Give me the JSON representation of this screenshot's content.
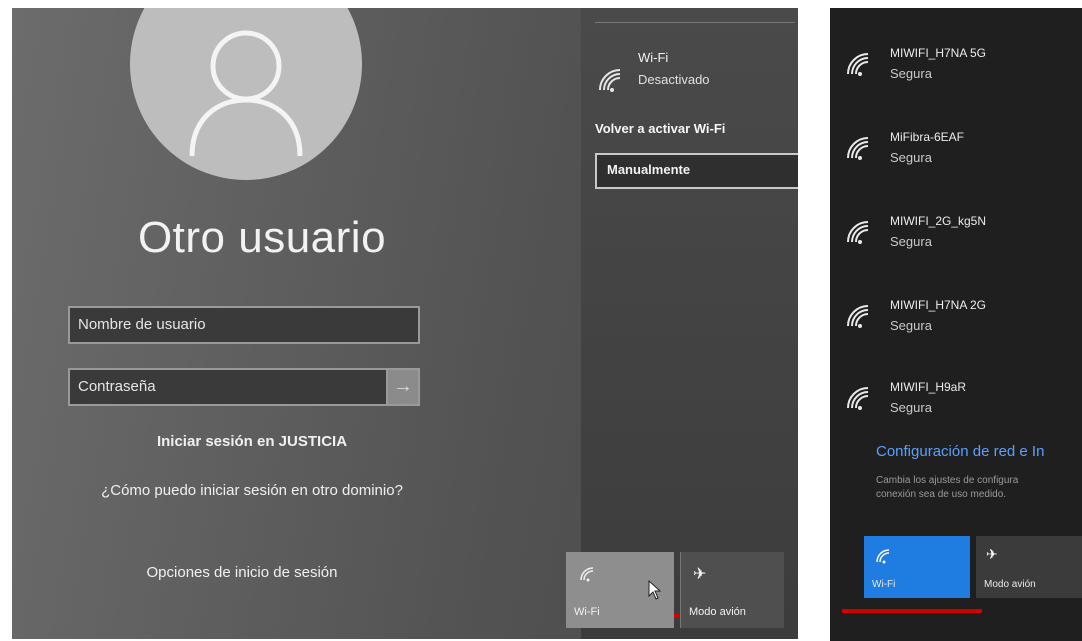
{
  "login": {
    "title": "Otro usuario",
    "username_placeholder": "Nombre de usuario",
    "password_placeholder": "Contraseña",
    "sign_in_justicia": "Iniciar sesión en JUSTICIA",
    "other_domain": "¿Cómo puedo iniciar sesión en otro dominio?",
    "sign_in_options": "Opciones de inicio de sesión"
  },
  "wifi_panel": {
    "wifi_name": "Wi-Fi",
    "wifi_state": "Desactivado",
    "reactivate_label": "Volver a activar Wi-Fi",
    "reactivate_value": "Manualmente",
    "tiles": [
      {
        "label": "Wi-Fi",
        "icon": "wifi-icon"
      },
      {
        "label": "Modo avión",
        "icon": "airplane-icon"
      }
    ]
  },
  "networks": [
    {
      "name": "MIWIFI_H7NA 5G",
      "status": "Segura"
    },
    {
      "name": "MiFibra-6EAF",
      "status": "Segura"
    },
    {
      "name": "MIWIFI_2G_kg5N",
      "status": "Segura"
    },
    {
      "name": "MIWIFI_H7NA 2G",
      "status": "Segura"
    },
    {
      "name": "MIWIFI_H9aR",
      "status": "Segura"
    }
  ],
  "network_settings": {
    "link": "Configuración de red e In",
    "desc_line1": "Cambia los ajustes de configura",
    "desc_line2": "conexión sea de uso medido."
  },
  "right_tiles": [
    {
      "label": "Wi-Fi",
      "icon": "wifi-icon"
    },
    {
      "label": "Modo avión",
      "icon": "airplane-icon"
    }
  ],
  "colors": {
    "accent": "#1f7ce0",
    "highlight": "#d00000",
    "link": "#5aa0ff"
  }
}
